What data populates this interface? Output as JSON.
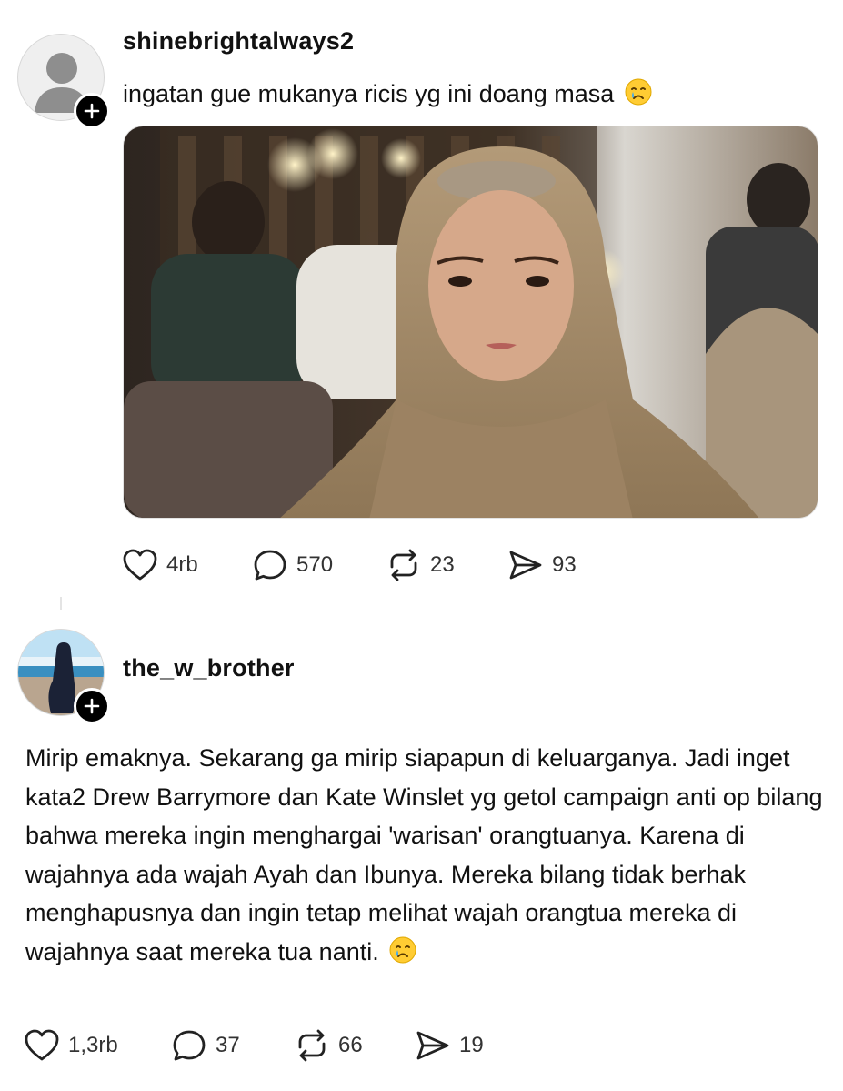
{
  "posts": [
    {
      "username": "shinebrightalways2",
      "text": "ingatan gue mukanya ricis yg ini doang masa",
      "emoji": "crying-face-emoji",
      "has_image": true,
      "likes": "4rb",
      "replies": "570",
      "reposts": "23",
      "shares": "93"
    },
    {
      "username": "the_w_brother",
      "text": "Mirip emaknya. Sekarang ga mirip siapapun di keluarganya. Jadi inget kata2 Drew Barrymore dan Kate Winslet yg getol campaign anti op bilang bahwa mereka ingin menghargai 'warisan' orangtuanya. Karena di wajahnya ada wajah Ayah dan Ibunya. Mereka bilang tidak berhak menghapusnya dan ingin tetap melihat wajah orangtua mereka di wajahnya saat mereka tua nanti.",
      "emoji": "crying-face-emoji",
      "likes": "1,3rb",
      "replies": "37",
      "reposts": "66",
      "shares": "19"
    }
  ],
  "colors": {
    "text": "#111111",
    "icon": "#222222",
    "badge": "#000000"
  }
}
